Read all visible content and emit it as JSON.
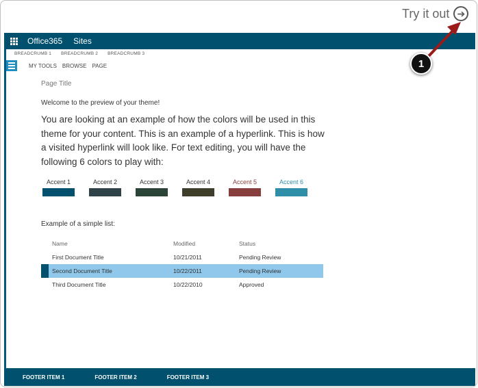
{
  "try_it": {
    "label": "Try it out",
    "icon": "arrow-right-circle-icon"
  },
  "suitebar": {
    "brand": "Office365",
    "sites": "Sites",
    "color": "#00506e"
  },
  "breadcrumb": [
    "BREADCRUMB 1",
    "BREADCRUMB 2",
    "BREADCRUMB 3"
  ],
  "nav": {
    "tabs": [
      "MY TOOLS",
      "BROWSE",
      "PAGE"
    ]
  },
  "page": {
    "title": "Page Title",
    "welcome": "Welcome to the preview of your theme!",
    "body": "You are looking at an example of how the colors will be used in this theme for your content. This is an example of a hyperlink. This is how a visited hyperlink will look like. For text editing, you will have the following 6 colors to play with:"
  },
  "accents": [
    {
      "label": "Accent 1",
      "color": "#00506e",
      "label_color": "#333333"
    },
    {
      "label": "Accent 2",
      "color": "#2e4247",
      "label_color": "#333333"
    },
    {
      "label": "Accent 3",
      "color": "#2c4437",
      "label_color": "#333333"
    },
    {
      "label": "Accent 4",
      "color": "#3f3e2a",
      "label_color": "#333333"
    },
    {
      "label": "Accent 5",
      "color": "#863f3d",
      "label_color": "#863f3d"
    },
    {
      "label": "Accent 6",
      "color": "#2f8fa8",
      "label_color": "#2f8fa8"
    }
  ],
  "list": {
    "caption": "Example of a simple list:",
    "columns": [
      "Name",
      "Modified",
      "Status"
    ],
    "rows": [
      {
        "name": "First Document Title",
        "modified": "10/21/2011",
        "status": "Pending Review",
        "selected": false
      },
      {
        "name": "Second Document Title",
        "modified": "10/22/2011",
        "status": "Pending Review",
        "selected": true
      },
      {
        "name": "Third Document Title",
        "modified": "10/22/2010",
        "status": "Approved",
        "selected": false
      }
    ]
  },
  "footer": {
    "items": [
      "FOOTER ITEM 1",
      "FOOTER ITEM 2",
      "FOOTER ITEM 3"
    ]
  },
  "callout": {
    "number": "1",
    "arrow_color": "#9b1b1b"
  }
}
